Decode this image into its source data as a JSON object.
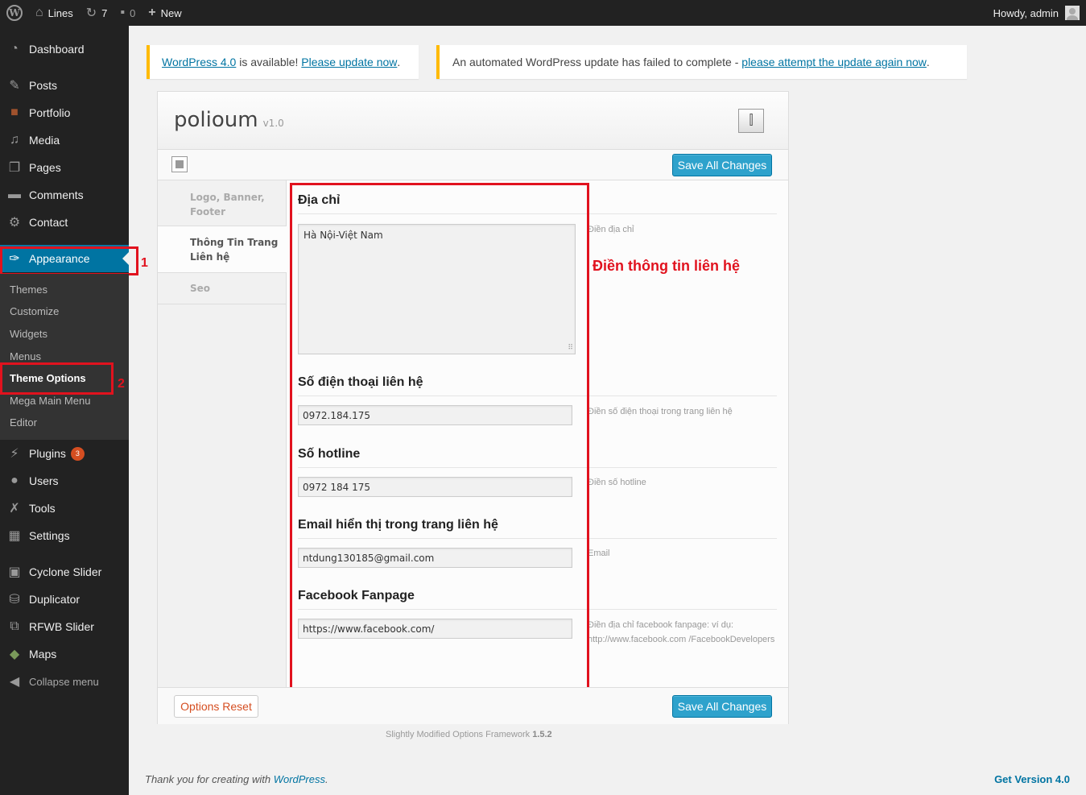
{
  "adminbar": {
    "site_name": "Lines",
    "updates_count": "7",
    "comments_count": "0",
    "new_label": "New",
    "howdy": "Howdy, admin"
  },
  "sidebar": {
    "items": [
      {
        "label": "Dashboard",
        "icon": "dashboard-icon"
      },
      {
        "label": "Posts",
        "icon": "pin-icon"
      },
      {
        "label": "Portfolio",
        "icon": "briefcase-icon"
      },
      {
        "label": "Media",
        "icon": "media-icon"
      },
      {
        "label": "Pages",
        "icon": "pages-icon"
      },
      {
        "label": "Comments",
        "icon": "comment-icon"
      },
      {
        "label": "Contact",
        "icon": "gear-icon"
      },
      {
        "label": "Appearance",
        "icon": "brush-icon"
      },
      {
        "label": "Plugins",
        "icon": "plug-icon",
        "badge": "3"
      },
      {
        "label": "Users",
        "icon": "user-icon"
      },
      {
        "label": "Tools",
        "icon": "wrench-icon"
      },
      {
        "label": "Settings",
        "icon": "settings-icon"
      },
      {
        "label": "Cyclone Slider",
        "icon": "slider-icon"
      },
      {
        "label": "Duplicator",
        "icon": "duplicator-icon"
      },
      {
        "label": "RFWB Slider",
        "icon": "slider-icon"
      },
      {
        "label": "Maps",
        "icon": "map-icon"
      },
      {
        "label": "Collapse menu",
        "icon": "collapse-icon"
      }
    ],
    "submenu": [
      "Themes",
      "Customize",
      "Widgets",
      "Menus",
      "Theme Options",
      "Mega Main Menu",
      "Editor"
    ],
    "marker1": "1",
    "marker2": "2"
  },
  "notices": {
    "n1_link1": "WordPress 4.0",
    "n1_text": " is available! ",
    "n1_link2": "Please update now",
    "n1_end": ".",
    "n2_text": "An automated WordPress update has failed to complete - ",
    "n2_link": "please attempt the update again now",
    "n2_end": "."
  },
  "panel": {
    "title": "polioum",
    "version": "v1.0",
    "save_label": "Save All Changes",
    "reset_label": "Options Reset",
    "tabs": [
      {
        "line1": "Logo, Banner,",
        "line2": "Footer"
      },
      {
        "line1": "Thông Tin Trang",
        "line2": "Liên hệ"
      },
      {
        "line1": "Seo",
        "line2": ""
      }
    ],
    "annotation": "Điền thông tin liên hệ",
    "sections": [
      {
        "title": "Địa chỉ",
        "value": "Hà Nội-Việt Nam",
        "desc": "Điền địa chỉ"
      },
      {
        "title": "Số điện thoại liên hệ",
        "value": "0972.184.175",
        "desc": "Điền số điện thoại trong trang liên hệ"
      },
      {
        "title": "Số hotline",
        "value": "0972 184 175",
        "desc": "Điền số hotline"
      },
      {
        "title": "Email hiển thị trong trang liên hệ",
        "value": "ntdung130185@gmail.com",
        "desc": "Email"
      },
      {
        "title": "Facebook Fanpage",
        "value": "https://www.facebook.com/",
        "desc": "Điền địa chỉ facebook fanpage: ví dụ: http://www.facebook.com /FacebookDevelopers"
      }
    ],
    "framework_text": "Slightly Modified Options Framework",
    "framework_version": "1.5.2"
  },
  "footer": {
    "thanks": "Thank you for creating with ",
    "wp_link": "WordPress",
    "thanks_end": ".",
    "version": "Get Version 4.0"
  },
  "colors": {
    "accent": "#0074a2",
    "highlight_red": "#e1121e",
    "notice_yellow": "#ffba00"
  }
}
